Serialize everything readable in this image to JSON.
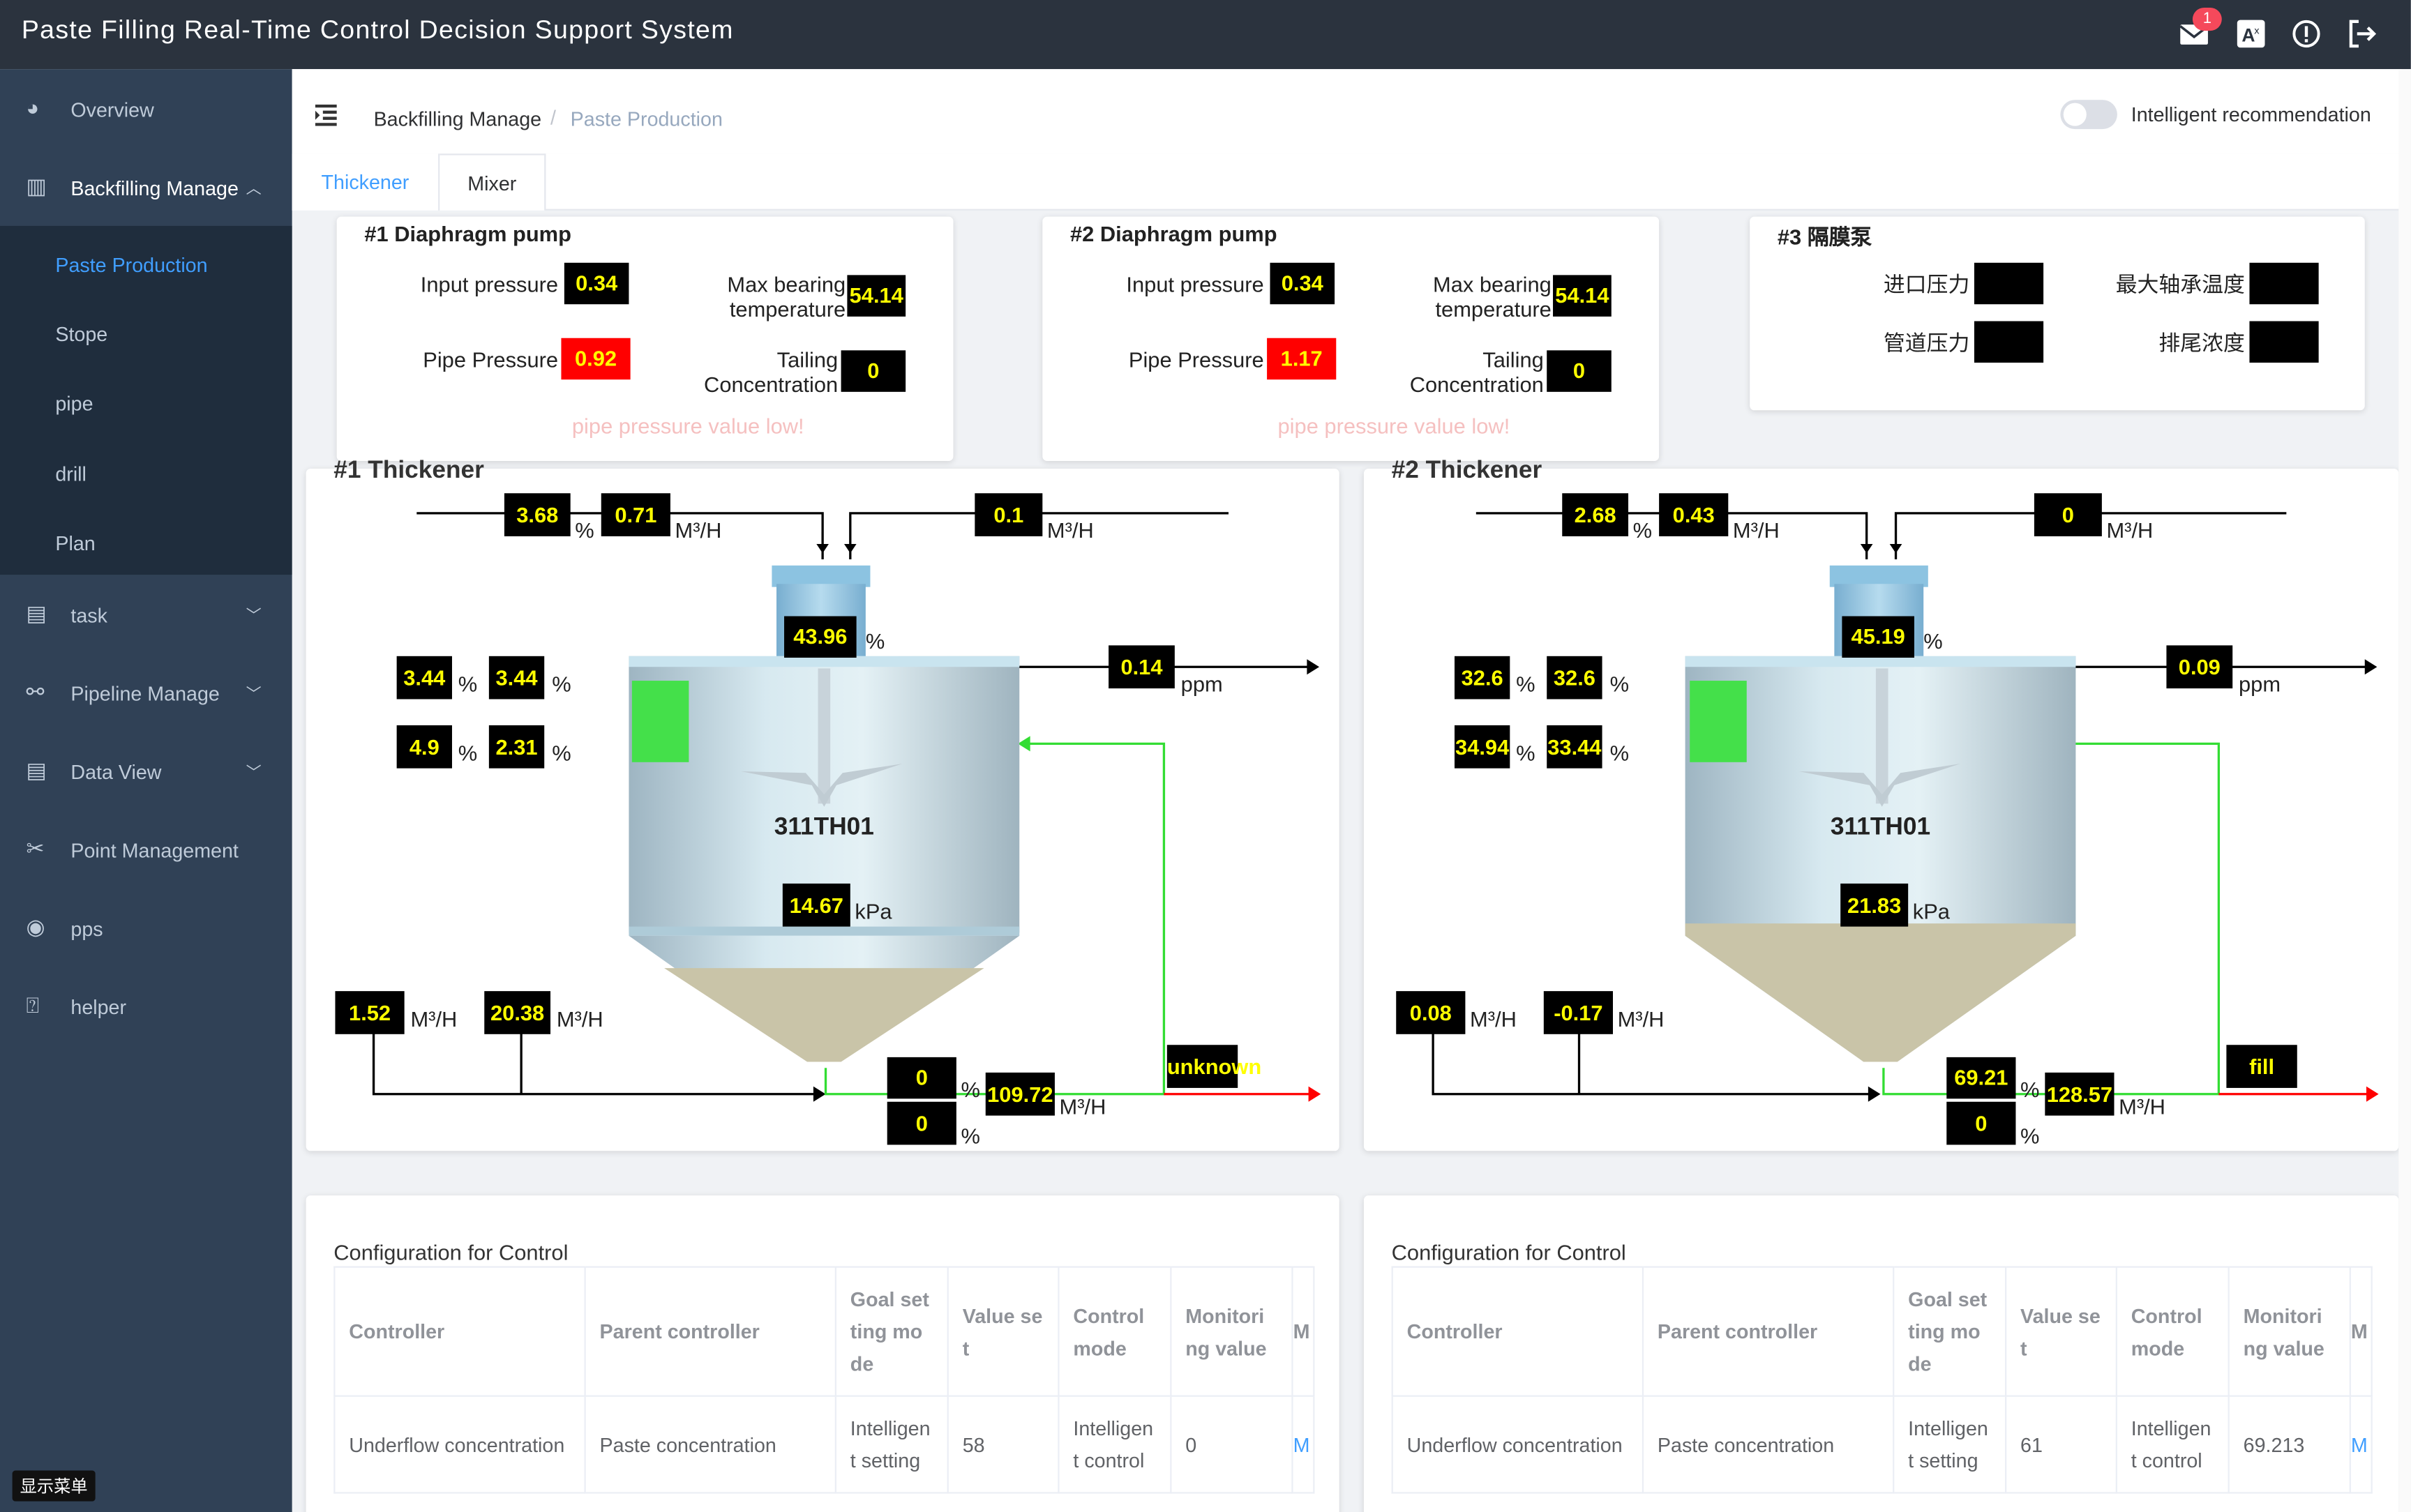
{
  "app": {
    "title": "Paste Filling Real-Time Control Decision Support System",
    "notification_count": "1"
  },
  "sidebar": {
    "items": [
      {
        "label": "Overview",
        "icon": "dashboard-icon"
      },
      {
        "label": "Backfilling Manage",
        "icon": "layout-icon"
      },
      {
        "label": "task",
        "icon": "document-icon"
      },
      {
        "label": "Pipeline Manage",
        "icon": "pipeline-icon"
      },
      {
        "label": "Data View",
        "icon": "document-icon"
      },
      {
        "label": "Point Management",
        "icon": "tools-icon"
      },
      {
        "label": "pps",
        "icon": "eye-icon"
      },
      {
        "label": "helper",
        "icon": "question-icon"
      }
    ],
    "sub_items": [
      "Paste Production",
      "Stope",
      "pipe",
      "drill",
      "Plan"
    ],
    "bottom_tag": "显示菜单"
  },
  "breadcrumb": {
    "first": "Backfilling Manage",
    "separator": "/",
    "second": "Paste Production"
  },
  "toggle": {
    "label": "Intelligent recommendation",
    "on": false
  },
  "tabs": [
    "Thickener",
    "Mixer"
  ],
  "pumps": [
    {
      "title": "#1 Diaphragm pump",
      "input_label": "Input pressure",
      "input_value": "0.34",
      "pipe_label": "Pipe Pressure",
      "pipe_value": "0.92",
      "temp_label_1": "Max bearing",
      "temp_label_2": "temperature",
      "temp_value": "54.14",
      "tail_label_1": "Tailing",
      "tail_label_2": "Concentration",
      "tail_value": "0",
      "warning": "pipe pressure value low!"
    },
    {
      "title": "#2 Diaphragm pump",
      "input_label": "Input pressure",
      "input_value": "0.34",
      "pipe_label": "Pipe Pressure",
      "pipe_value": "1.17",
      "temp_label_1": "Max bearing",
      "temp_label_2": "temperature",
      "temp_value": "54.14",
      "tail_label_1": "Tailing",
      "tail_label_2": "Concentration",
      "tail_value": "0",
      "warning": "pipe pressure value low!"
    },
    {
      "title": "#3 隔膜泵",
      "input_label": "进口压力",
      "pipe_label": "管道压力",
      "temp_label": "最大轴承温度",
      "tail_label": "排尾浓度"
    }
  ],
  "thickeners": [
    {
      "title": "#1 Thickener",
      "name": "311TH01",
      "feed_conc": "3.68",
      "feed_flow": "0.71",
      "floc_flow": "0.1",
      "top_conc": "43.96",
      "overflow": "0.14",
      "l1": "3.44",
      "l2": "3.44",
      "l3": "4.9",
      "l4": "2.31",
      "pressure": "14.67",
      "in_flow1": "1.52",
      "in_flow2": "20.38",
      "under_conc1": "0",
      "under_conc2": "0",
      "under_flow": "109.72",
      "status": "unknown"
    },
    {
      "title": "#2 Thickener",
      "name": "311TH01",
      "feed_conc": "2.68",
      "feed_flow": "0.43",
      "floc_flow": "0",
      "top_conc": "45.19",
      "overflow": "0.09",
      "l1": "32.6",
      "l2": "32.6",
      "l3": "34.94",
      "l4": "33.44",
      "pressure": "21.83",
      "in_flow1": "0.08",
      "in_flow2": "-0.17",
      "under_conc1": "69.21",
      "under_conc2": "0",
      "under_flow": "128.57",
      "status": "fill"
    }
  ],
  "units": {
    "flow": "M³/H",
    "percent": "%",
    "ppm": "ppm",
    "kpa": "kPa"
  },
  "config": [
    {
      "title": "Configuration for Control",
      "headers": [
        "Controller",
        "Parent controller",
        "Goal set ting mo de",
        "Value se t",
        "Control mode",
        "Monitori ng value",
        "M"
      ],
      "row": [
        "Underflow concentration",
        "Paste concentration",
        "Intelligen t setting",
        "58",
        "Intelligen t control",
        "0",
        "M"
      ]
    },
    {
      "title": "Configuration for Control",
      "headers": [
        "Controller",
        "Parent controller",
        "Goal set ting mo de",
        "Value se t",
        "Control mode",
        "Monitori ng value",
        "M"
      ],
      "row": [
        "Underflow concentration",
        "Paste concentration",
        "Intelligen t setting",
        "61",
        "Intelligen t control",
        "69.213",
        "M"
      ]
    }
  ],
  "colors": {
    "topbar": "#2b333e",
    "sidebar": "#304156",
    "submenu": "#1f2d3d",
    "accent": "#409eff",
    "value_bg": "#000000",
    "value_fg": "#ffff00",
    "alarm": "#ff0000",
    "flow_line": "#33dd33"
  }
}
